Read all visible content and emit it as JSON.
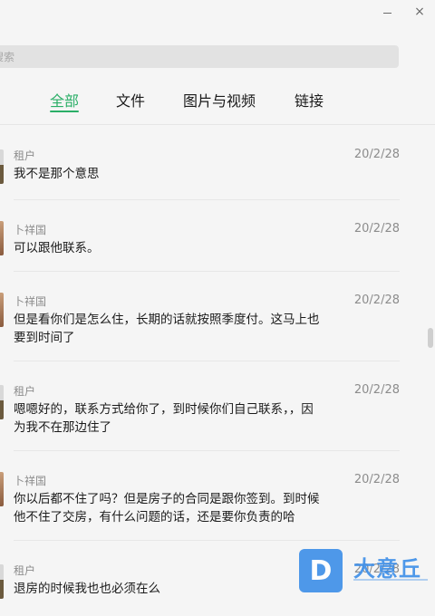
{
  "window": {
    "minimize_label": "—",
    "close_label": "×"
  },
  "search": {
    "placeholder": "搜索"
  },
  "tabs": [
    {
      "label": "全部",
      "active": true
    },
    {
      "label": "文件",
      "active": false
    },
    {
      "label": "图片与视频",
      "active": false
    },
    {
      "label": "链接",
      "active": false
    }
  ],
  "messages": [
    {
      "sender": "租户",
      "date": "20/2/28",
      "lines": [
        "我不是那个意思"
      ]
    },
    {
      "sender": "卜祥国",
      "date": "20/2/28",
      "lines": [
        "可以跟他联系。"
      ]
    },
    {
      "sender": "卜祥国",
      "date": "20/2/28",
      "lines": [
        "但是看你们是怎么住，长期的话就按照季度付。这马上也",
        "要到时间了"
      ]
    },
    {
      "sender": "租户",
      "date": "20/2/28",
      "lines": [
        "嗯嗯好的，联系方式给你了，到时候你们自己联系，，因",
        "为我不在那边住了"
      ]
    },
    {
      "sender": "卜祥国",
      "date": "20/2/28",
      "lines": [
        "你以后都不住了吗？但是房子的合同是跟你签到。到时候",
        "他不住了交房，有什么问题的话，还是要你负责的哈"
      ]
    },
    {
      "sender": "租户",
      "date": "20/2/28",
      "lines": [
        "退房的时候我也也必须在么"
      ]
    }
  ],
  "watermark": {
    "logo_letter": "D",
    "text": "大意丘"
  }
}
